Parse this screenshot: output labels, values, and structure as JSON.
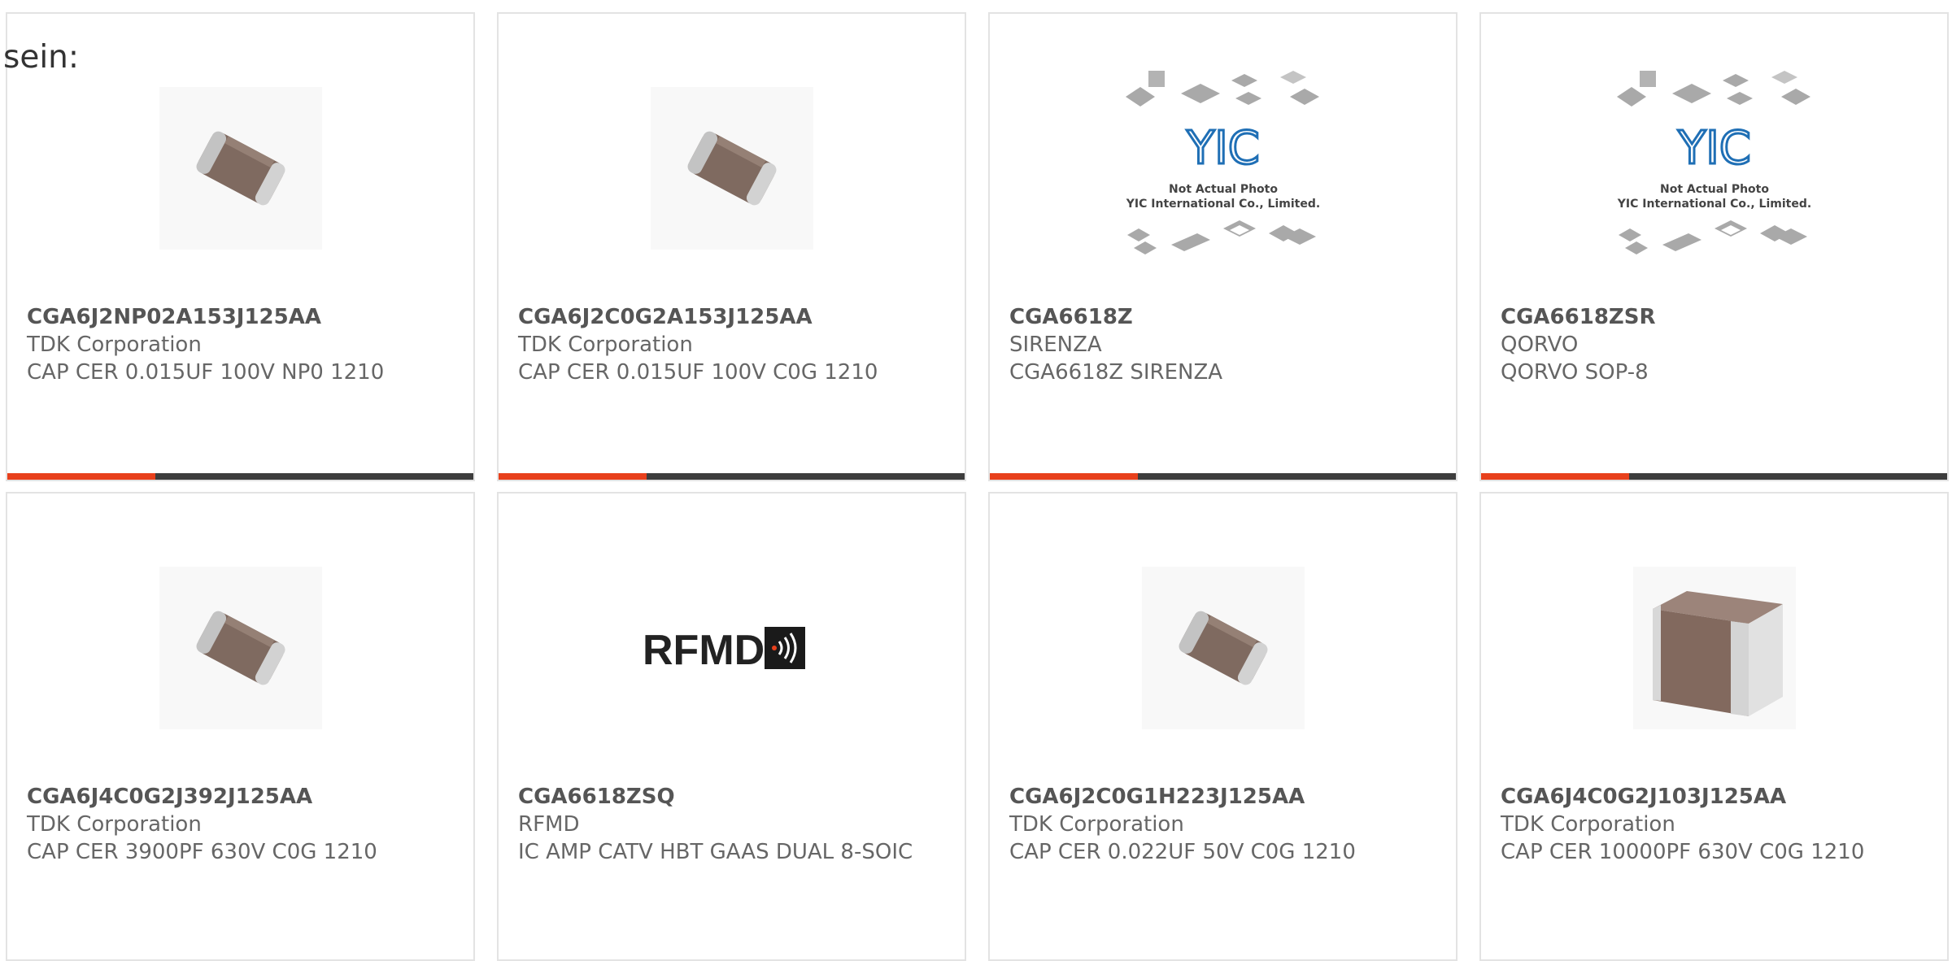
{
  "intro_text": "sein:",
  "colors": {
    "accent": "#e8401c",
    "bar_dark": "#3d3d3d",
    "card_border": "#e3e3e3",
    "text": "#555555"
  },
  "products": [
    {
      "part": "CGA6J2NP02A153J125AA",
      "maker": "TDK Corporation",
      "desc": "CAP CER 0.015UF 100V NP0 1210",
      "image": "capacitor-chip-icon"
    },
    {
      "part": "CGA6J2C0G2A153J125AA",
      "maker": "TDK Corporation",
      "desc": "CAP CER 0.015UF 100V C0G 1210",
      "image": "capacitor-chip-icon"
    },
    {
      "part": "CGA6618Z",
      "maker": "SIRENZA",
      "desc": "CGA6618Z SIRENZA",
      "image": "yic-placeholder-image",
      "img_text": {
        "logo": "YIC",
        "line1": "Not Actual Photo",
        "line2": "YIC International Co., Limited."
      }
    },
    {
      "part": "CGA6618ZSR",
      "maker": "QORVO",
      "desc": "QORVO SOP-8",
      "image": "yic-placeholder-image",
      "img_text": {
        "logo": "YIC",
        "line1": "Not Actual Photo",
        "line2": "YIC International Co., Limited."
      }
    },
    {
      "part": "CGA6J4C0G2J392J125AA",
      "maker": "TDK Corporation",
      "desc": "CAP CER 3900PF 630V C0G 1210",
      "image": "capacitor-chip-icon"
    },
    {
      "part": "CGA6618ZSQ",
      "maker": "RFMD",
      "desc": "IC AMP CATV HBT GAAS DUAL 8-SOIC",
      "image": "rfmd-logo",
      "img_text": {
        "logo": "RFMD"
      }
    },
    {
      "part": "CGA6J2C0G1H223J125AA",
      "maker": "TDK Corporation",
      "desc": "CAP CER 0.022UF 50V C0G 1210",
      "image": "capacitor-chip-icon"
    },
    {
      "part": "CGA6J4C0G2J103J125AA",
      "maker": "TDK Corporation",
      "desc": "CAP CER 10000PF 630V C0G 1210",
      "image": "capacitor-large-icon"
    }
  ]
}
